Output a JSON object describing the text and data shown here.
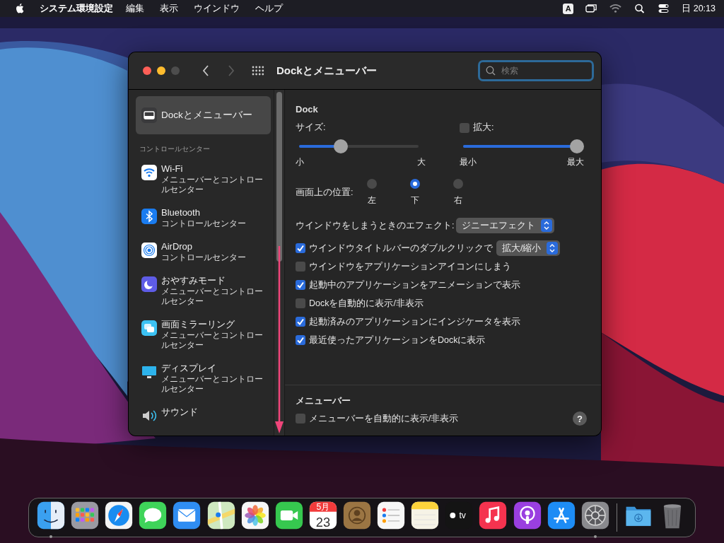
{
  "menu_bar": {
    "app_name": "システム環境設定",
    "menus": [
      "編集",
      "表示",
      "ウインドウ",
      "ヘルプ"
    ],
    "input_source": "A",
    "clock": "日 20:13"
  },
  "window": {
    "title": "Dockとメニューバー",
    "search": {
      "placeholder": "検索"
    },
    "sidebar": {
      "items": [
        {
          "kind": "pane",
          "title": "Dockとメニューバー",
          "selected": true
        },
        {
          "kind": "header",
          "title": "コントロールセンター"
        },
        {
          "kind": "pane",
          "title": "Wi-Fi",
          "subtitle": "メニューバーとコントロールセンター",
          "selected": false
        },
        {
          "kind": "pane",
          "title": "Bluetooth",
          "subtitle": "コントロールセンター",
          "selected": false
        },
        {
          "kind": "pane",
          "title": "AirDrop",
          "subtitle": "コントロールセンター",
          "selected": false
        },
        {
          "kind": "pane",
          "title": "おやすみモード",
          "subtitle": "メニューバーとコントロールセンター",
          "selected": false
        },
        {
          "kind": "pane",
          "title": "画面ミラーリング",
          "subtitle": "メニューバーとコントロールセンター",
          "selected": false
        },
        {
          "kind": "pane",
          "title": "ディスプレイ",
          "subtitle": "メニューバーとコントロールセンター",
          "selected": false
        },
        {
          "kind": "pane",
          "title": "サウンド",
          "selected": false
        }
      ]
    },
    "dock_section": {
      "title": "Dock",
      "size": {
        "label": "サイズ:",
        "level": 0.35,
        "min_label": "小",
        "max_label": "大"
      },
      "magnification": {
        "label": "拡大:",
        "checked": false,
        "level": 1,
        "min_label": "最小",
        "max_label": "最大"
      },
      "position": {
        "label": "画面上の位置:",
        "options": [
          {
            "label": "左",
            "selected": false
          },
          {
            "label": "下",
            "selected": true
          },
          {
            "label": "右",
            "selected": false
          }
        ]
      },
      "minimize_effect": {
        "label": "ウインドウをしまうときのエフェクト:",
        "value": "ジニーエフェクト"
      },
      "options": [
        {
          "label": "ウインドウタイトルバーのダブルクリックで",
          "checked": true,
          "popup": "拡大/縮小"
        },
        {
          "label": "ウインドウをアプリケーションアイコンにしまう",
          "checked": false
        },
        {
          "label": "起動中のアプリケーションをアニメーションで表示",
          "checked": true
        },
        {
          "label": "Dockを自動的に表示/非表示",
          "checked": false
        },
        {
          "label": "起動済みのアプリケーションにインジケータを表示",
          "checked": true
        },
        {
          "label": "最近使ったアプリケーションをDockに表示",
          "checked": true
        }
      ]
    },
    "menu_bar_section": {
      "title": "メニューバー",
      "options": [
        {
          "label": "メニューバーを自動的に表示/非表示",
          "checked": false
        }
      ]
    },
    "help_button": "?"
  },
  "dock": {
    "apps": [
      {
        "running": true
      },
      {
        "running": false
      },
      {
        "running": false
      },
      {
        "running": false
      },
      {
        "running": false
      },
      {
        "running": false
      },
      {
        "running": false
      },
      {
        "running": false
      },
      {
        "running": false,
        "month": "5月",
        "day": "23"
      },
      {
        "running": false
      },
      {
        "running": false
      },
      {
        "running": false
      },
      {
        "running": false,
        "label": "tv"
      },
      {
        "running": false
      },
      {
        "running": false
      },
      {
        "running": false
      },
      {
        "running": true
      },
      {
        "running": false
      },
      {
        "running": false
      }
    ]
  }
}
